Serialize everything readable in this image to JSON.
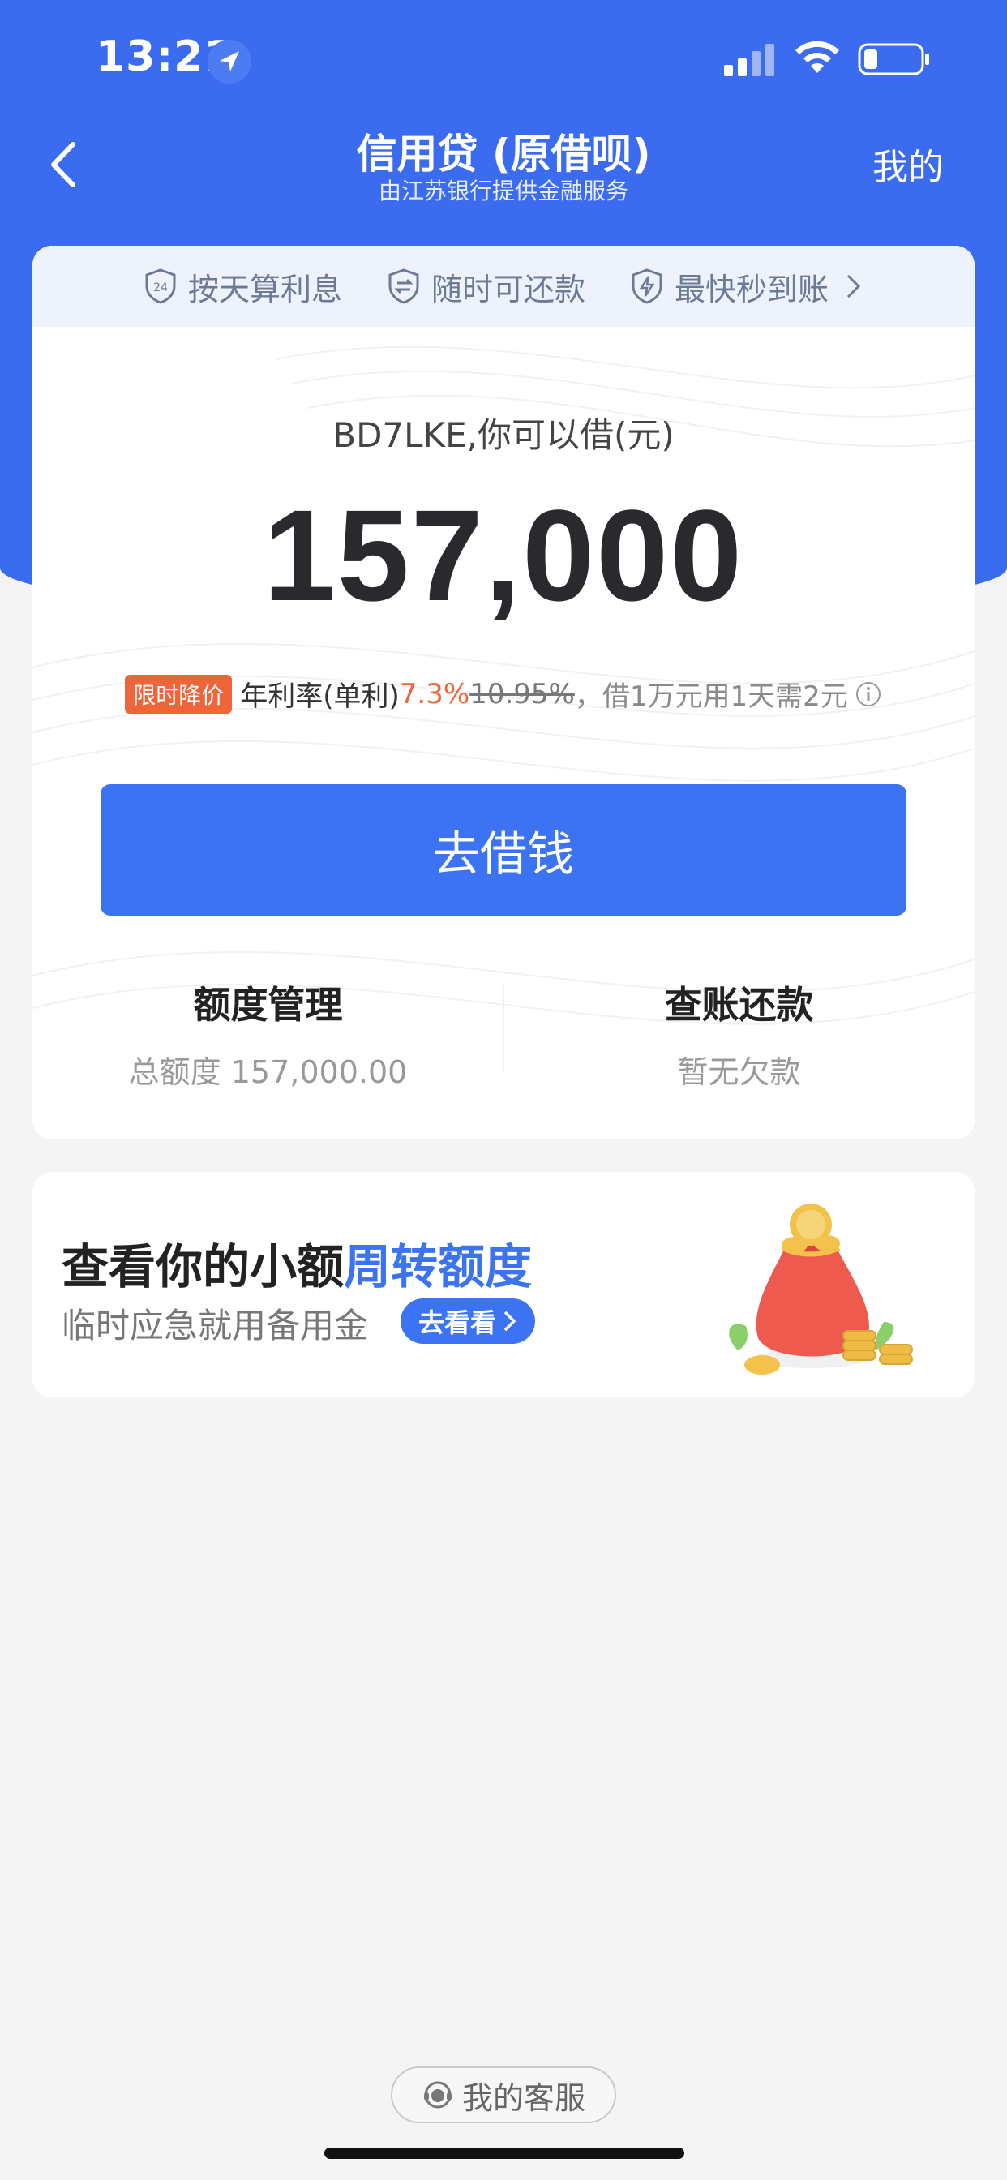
{
  "status_bar": {
    "time": "13:21"
  },
  "nav": {
    "title": "信用贷 (原借呗)",
    "subtitle": "由江苏银行提供金融服务",
    "mine_label": "我的"
  },
  "features": [
    {
      "label": "按天算利息",
      "icon": "calendar-24-shield-icon"
    },
    {
      "label": "随时可还款",
      "icon": "exchange-shield-icon"
    },
    {
      "label": "最快秒到账",
      "icon": "lightning-shield-icon"
    }
  ],
  "loan": {
    "greeting": "BD7LKE,你可以借(元)",
    "amount": "157,000",
    "promo_tag": "限时降价",
    "rate_label": "年利率(单利)",
    "rate_new": "7.3%",
    "rate_old": "10.95%",
    "rate_note": "，借1万元用1天需2元",
    "borrow_button": "去借钱"
  },
  "links": {
    "quota_title": "额度管理",
    "quota_sub": "总额度 157,000.00",
    "bill_title": "查账还款",
    "bill_sub": "暂无欠款"
  },
  "promo": {
    "title_prefix": "查看你的小额",
    "title_highlight": "周转额度",
    "subtitle": "临时应急就用备用金",
    "button": "去看看"
  },
  "service": {
    "label": "我的客服"
  },
  "colors": {
    "brand_blue": "#3b6cf0",
    "accent_orange": "#f0643a"
  }
}
